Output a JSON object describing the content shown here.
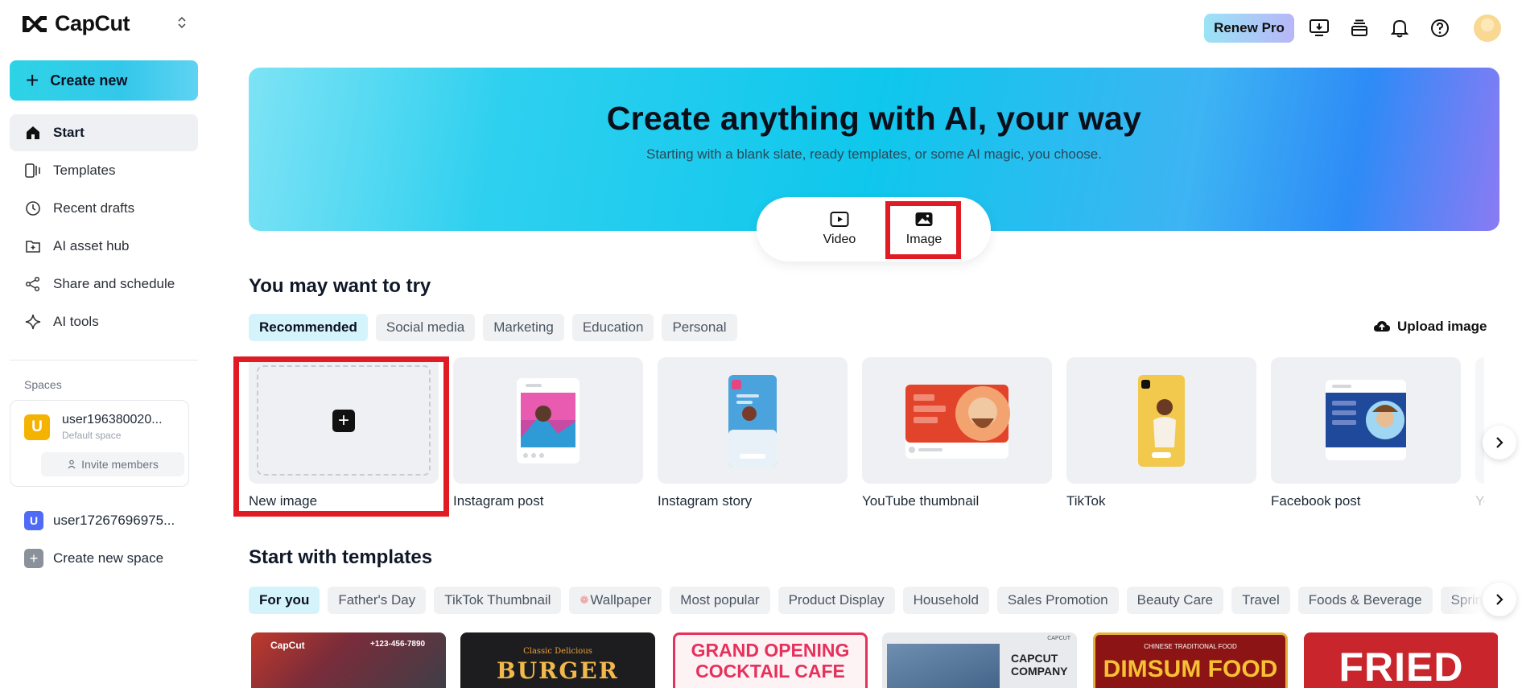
{
  "app": {
    "logo_text": "CapCut"
  },
  "sidebar": {
    "create_new": "Create new",
    "items": [
      {
        "label": "Start",
        "icon": "home-icon",
        "active": true
      },
      {
        "label": "Templates",
        "icon": "templates-icon"
      },
      {
        "label": "Recent drafts",
        "icon": "clock-icon"
      },
      {
        "label": "AI asset hub",
        "icon": "asset-hub-icon"
      },
      {
        "label": "Share and schedule",
        "icon": "share-icon"
      },
      {
        "label": "AI tools",
        "icon": "sparkle-icon"
      }
    ],
    "spaces_label": "Spaces",
    "space": {
      "avatar": "U",
      "name": "user196380020...",
      "sub": "Default space",
      "invite": "Invite members"
    },
    "other_space": {
      "avatar": "U",
      "name": "user17267696975..."
    },
    "new_space": {
      "avatar": "+",
      "label": "Create new space"
    }
  },
  "topbar": {
    "renew": "Renew Pro"
  },
  "hero": {
    "title": "Create anything with AI, your way",
    "subtitle": "Starting with a blank slate, ready templates, or some AI magic, you choose.",
    "modes": [
      "Video",
      "Image"
    ]
  },
  "try_section": {
    "title": "You may want to try",
    "chips": [
      "Recommended",
      "Social media",
      "Marketing",
      "Education",
      "Personal"
    ],
    "upload": "Upload image",
    "cards": [
      "New image",
      "Instagram post",
      "Instagram story",
      "YouTube thumbnail",
      "TikTok",
      "Facebook post",
      "Yo"
    ]
  },
  "templates_section": {
    "title": "Start with templates",
    "chips": [
      "For you",
      "Father's Day",
      "TikTok Thumbnail",
      "Wallpaper",
      "Most popular",
      "Product Display",
      "Household",
      "Sales Promotion",
      "Beauty Care",
      "Travel",
      "Foods & Beverage",
      "Spring"
    ],
    "cards": [
      {
        "top": "CapCut",
        "text": "+123-456-7890"
      },
      {
        "top": "Classic Delicious",
        "text": "BURGER"
      },
      {
        "top": "GRAND OPENING",
        "text": "COCKTAIL CAFE"
      },
      {
        "top": "CAPCUT",
        "text": "CAPCUT COMPANY"
      },
      {
        "top": "CHINESE TRADITIONAL FOOD",
        "text": "DIMSUM FOOD"
      },
      {
        "top": "",
        "text": "FRIED"
      }
    ]
  },
  "colors": {
    "accent": "#00c8e6",
    "highlight": "#e01b24"
  }
}
